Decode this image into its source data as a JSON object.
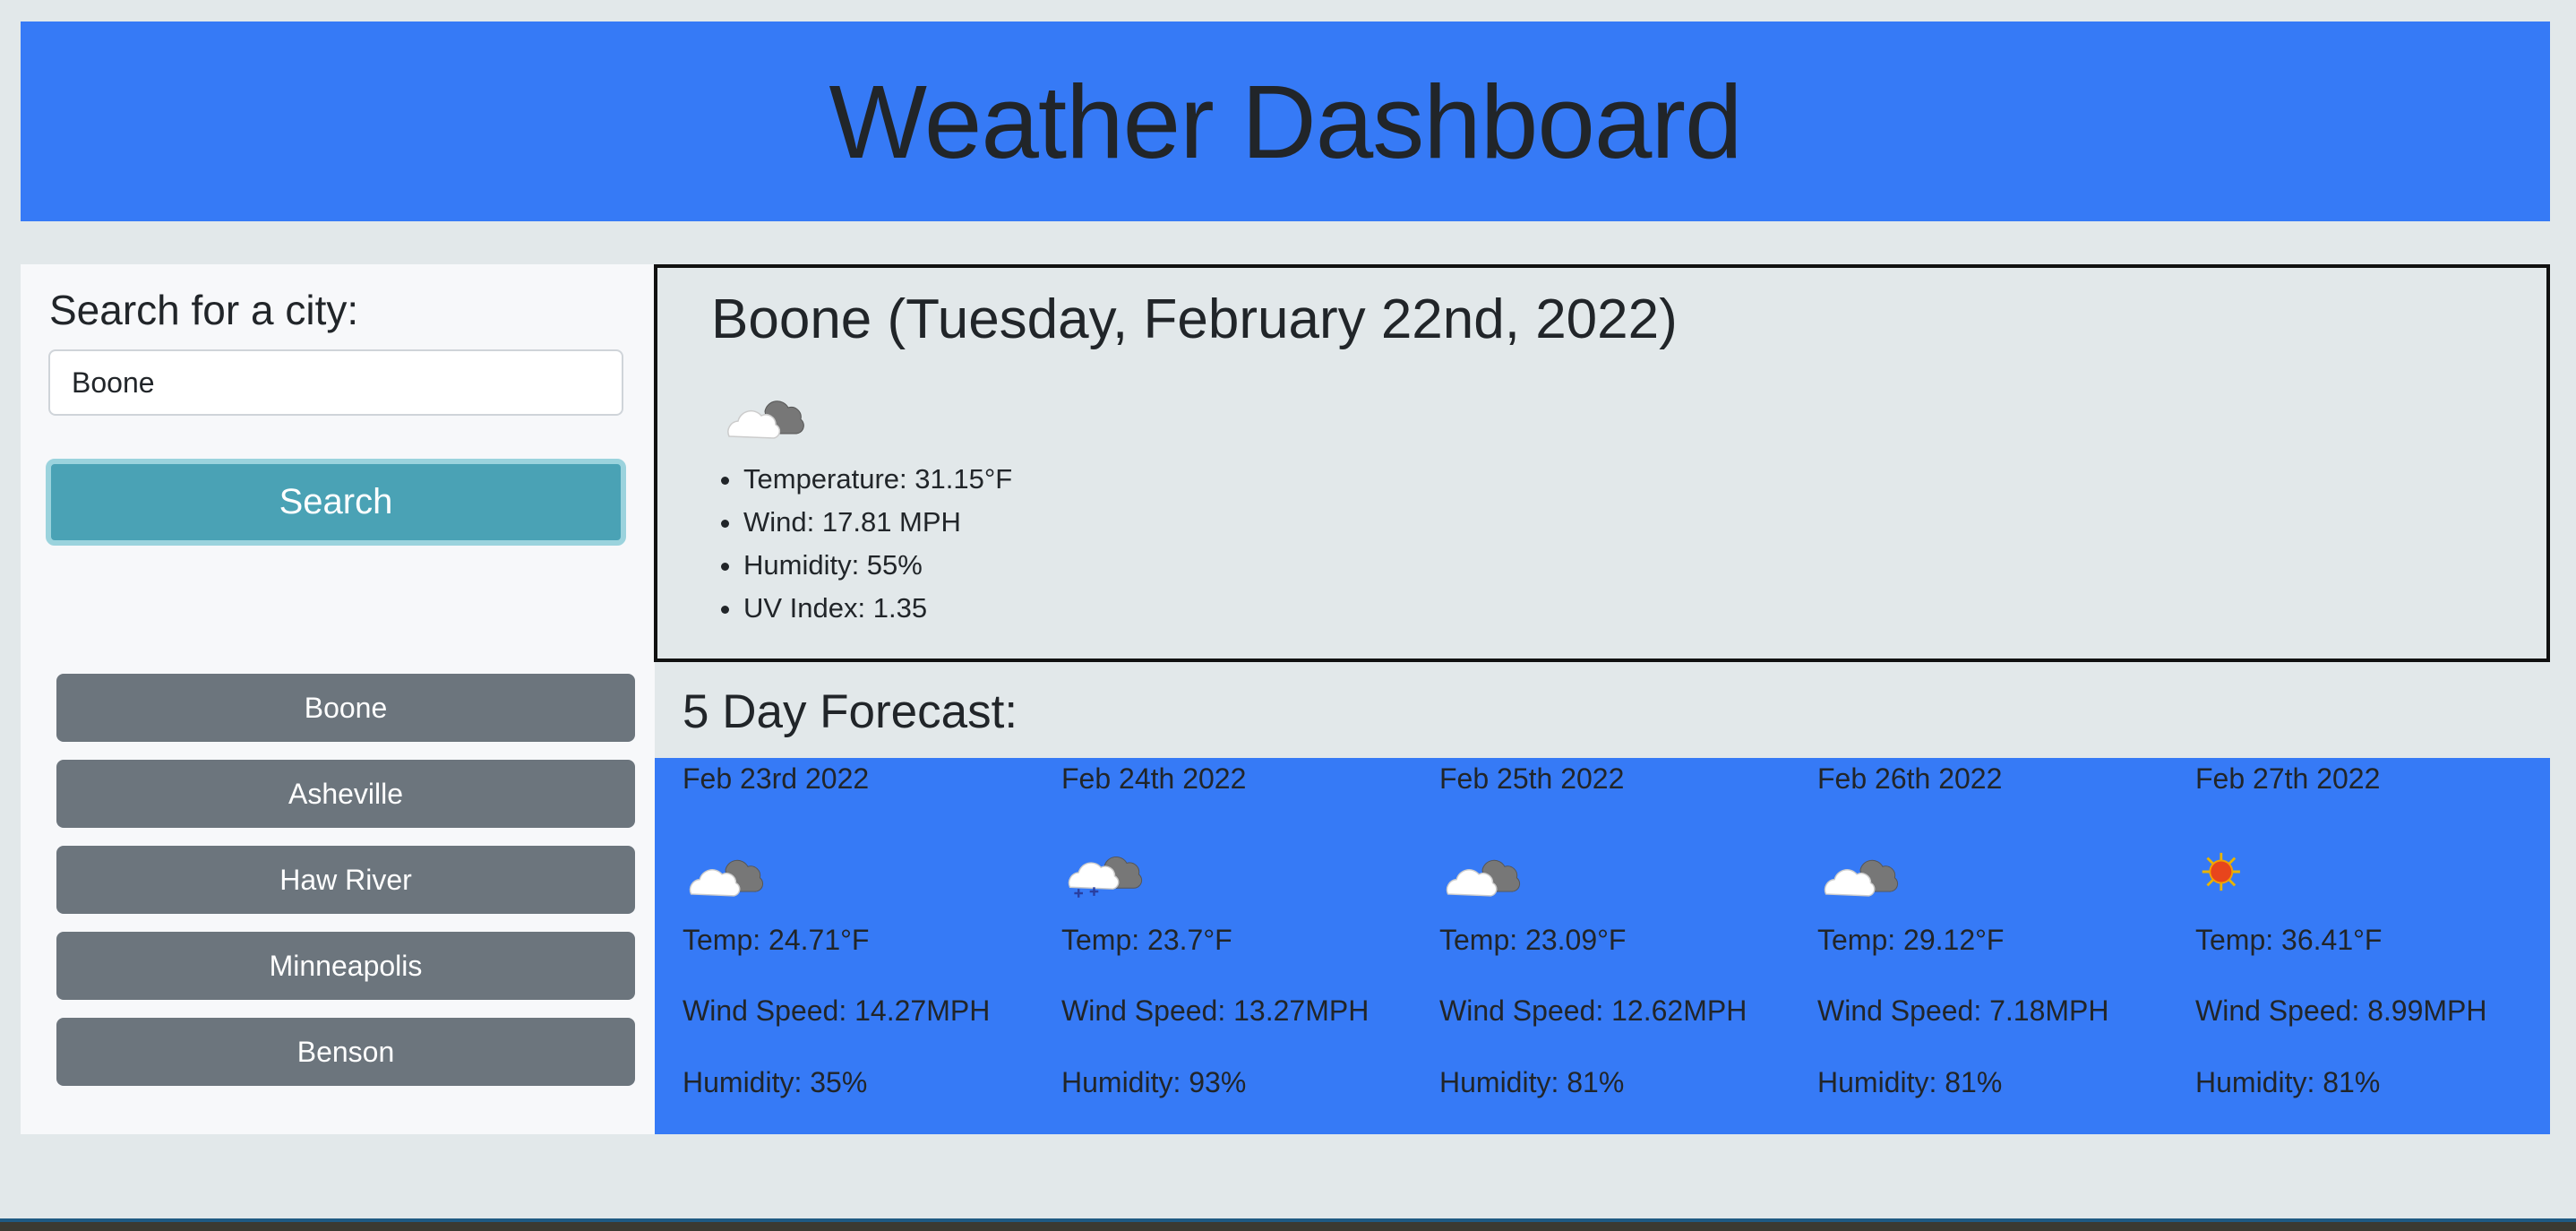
{
  "header": {
    "title": "Weather Dashboard"
  },
  "sidebar": {
    "search_label": "Search for a city:",
    "search_value": "Boone",
    "search_button": "Search",
    "history": [
      "Boone",
      "Asheville",
      "Haw River",
      "Minneapolis",
      "Benson"
    ]
  },
  "current": {
    "heading": "Boone (Tuesday, February 22nd, 2022)",
    "icon": "cloudy-icon",
    "temperature": "Temperature: 31.15°F",
    "wind": "Wind: 17.81 MPH",
    "humidity": "Humidity: 55%",
    "uv": "UV Index: 1.35"
  },
  "forecast": {
    "title": "5 Day Forecast:",
    "days": [
      {
        "date": "Feb 23rd 2022",
        "icon": "cloudy-icon",
        "temp": "Temp: 24.71°F",
        "wind": "Wind Speed: 14.27MPH",
        "humidity": "Humidity: 35%"
      },
      {
        "date": "Feb 24th 2022",
        "icon": "snow-icon",
        "temp": "Temp: 23.7°F",
        "wind": "Wind Speed: 13.27MPH",
        "humidity": "Humidity: 93%"
      },
      {
        "date": "Feb 25th 2022",
        "icon": "cloudy-icon",
        "temp": "Temp: 23.09°F",
        "wind": "Wind Speed: 12.62MPH",
        "humidity": "Humidity: 81%"
      },
      {
        "date": "Feb 26th 2022",
        "icon": "cloudy-icon",
        "temp": "Temp: 29.12°F",
        "wind": "Wind Speed: 7.18MPH",
        "humidity": "Humidity: 81%"
      },
      {
        "date": "Feb 27th 2022",
        "icon": "sun-icon",
        "temp": "Temp: 36.41°F",
        "wind": "Wind Speed: 8.99MPH",
        "humidity": "Humidity: 81%"
      }
    ]
  },
  "colors": {
    "header_bg": "#367af6",
    "forecast_bg": "#367af6",
    "search_button": "#4aa2b5",
    "history_button": "#6c757d",
    "page_bg": "#e2e8ea"
  }
}
